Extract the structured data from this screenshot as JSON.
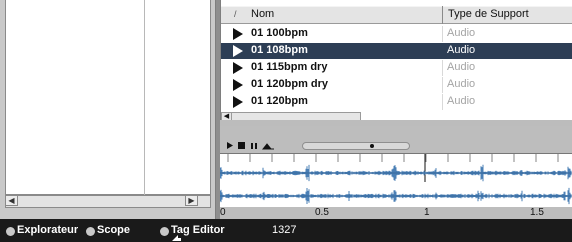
{
  "file_list": {
    "sort_indicator": "/",
    "columns": [
      "Nom",
      "Type de Support"
    ],
    "rows": [
      {
        "name": "01 100bpm",
        "type": "Audio",
        "selected": false
      },
      {
        "name": "01 108bpm",
        "type": "Audio",
        "selected": true
      },
      {
        "name": "01 115bpm dry",
        "type": "Audio",
        "selected": false
      },
      {
        "name": "01 120bpm dry",
        "type": "Audio",
        "selected": false
      },
      {
        "name": "01 120bpm",
        "type": "Audio",
        "selected": false
      }
    ]
  },
  "preview": {
    "transport_icons": [
      "play-icon",
      "stop-icon",
      "pause-icon",
      "autoplay-icon"
    ],
    "timeline_labels": [
      "0",
      "0.5",
      "1",
      "1.5"
    ],
    "waveform_color": "#4a7fb5"
  },
  "status_bar": {
    "tabs": [
      "Explorateur",
      "Scope",
      "Tag Editor"
    ],
    "count": "1327"
  },
  "colors": {
    "selection": "#2d3e55",
    "status_bar_bg": "#1a1a1a",
    "pane_bg": "#c9c9c9"
  }
}
